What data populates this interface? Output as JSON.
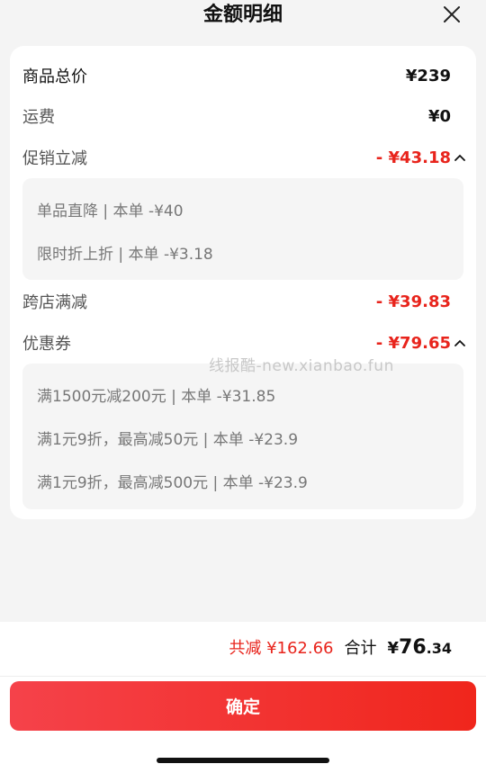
{
  "header": {
    "title": "金额明细"
  },
  "rows": {
    "total_price": {
      "label": "商品总价",
      "value": "¥239"
    },
    "shipping": {
      "label": "运费",
      "value": "¥0"
    },
    "promo": {
      "label": "促销立减",
      "value": "- ¥43.18",
      "details": [
        "单品直降 | 本单 -¥40",
        "限时折上折 | 本单 -¥3.18"
      ]
    },
    "cross_store": {
      "label": "跨店满减",
      "value": "- ¥39.83"
    },
    "coupon": {
      "label": "优惠券",
      "value": "- ¥79.65",
      "details": [
        "满1500元减200元 | 本单 -¥31.85",
        "满1元9折，最高减50元 | 本单 -¥23.9",
        "满1元9折，最高减500元 | 本单 -¥23.9"
      ]
    }
  },
  "watermark": "线报酷-new.xianbao.fun",
  "footer": {
    "saved": "共减 ¥162.66",
    "total_label": "合计",
    "total_currency": "¥",
    "total_int": "76",
    "total_dec": ".34",
    "confirm_label": "确定"
  },
  "colors": {
    "accent": "#e8241c",
    "button": "#f0261c"
  }
}
